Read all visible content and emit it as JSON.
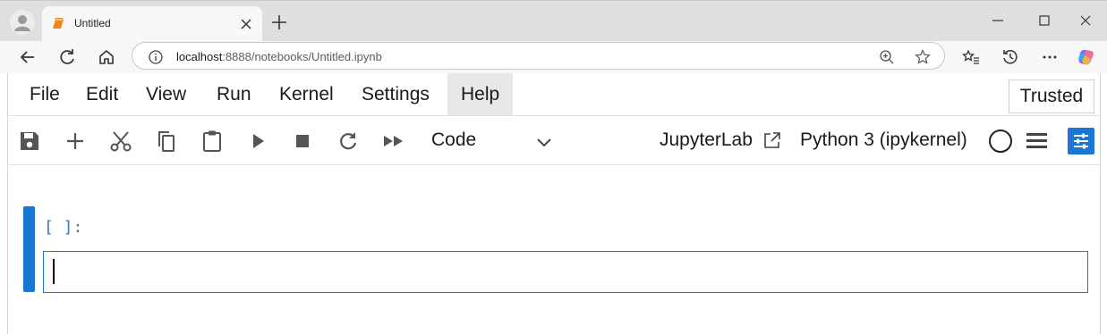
{
  "browser": {
    "tab": {
      "title": "Untitled",
      "favicon": "jupyter-notebook-icon"
    },
    "address": {
      "host": "localhost",
      "path": ":8888/notebooks/Untitled.ipynb"
    }
  },
  "menubar": {
    "items": [
      "File",
      "Edit",
      "View",
      "Run",
      "Kernel",
      "Settings",
      "Help"
    ],
    "active": "Help",
    "trusted_label": "Trusted"
  },
  "toolbar": {
    "cell_type": "Code",
    "jupyterlab_link": "JupyterLab",
    "kernel_name": "Python 3 (ipykernel)",
    "icons": [
      "save-icon",
      "add-cell-icon",
      "cut-icon",
      "copy-icon",
      "paste-icon",
      "run-icon",
      "stop-icon",
      "restart-icon",
      "run-all-icon"
    ]
  },
  "cell": {
    "prompt": "[ ]:",
    "source": ""
  },
  "colors": {
    "accent": "#1976d2",
    "prompt": "#3f74c0",
    "tab_favicon": "#f0861d"
  }
}
